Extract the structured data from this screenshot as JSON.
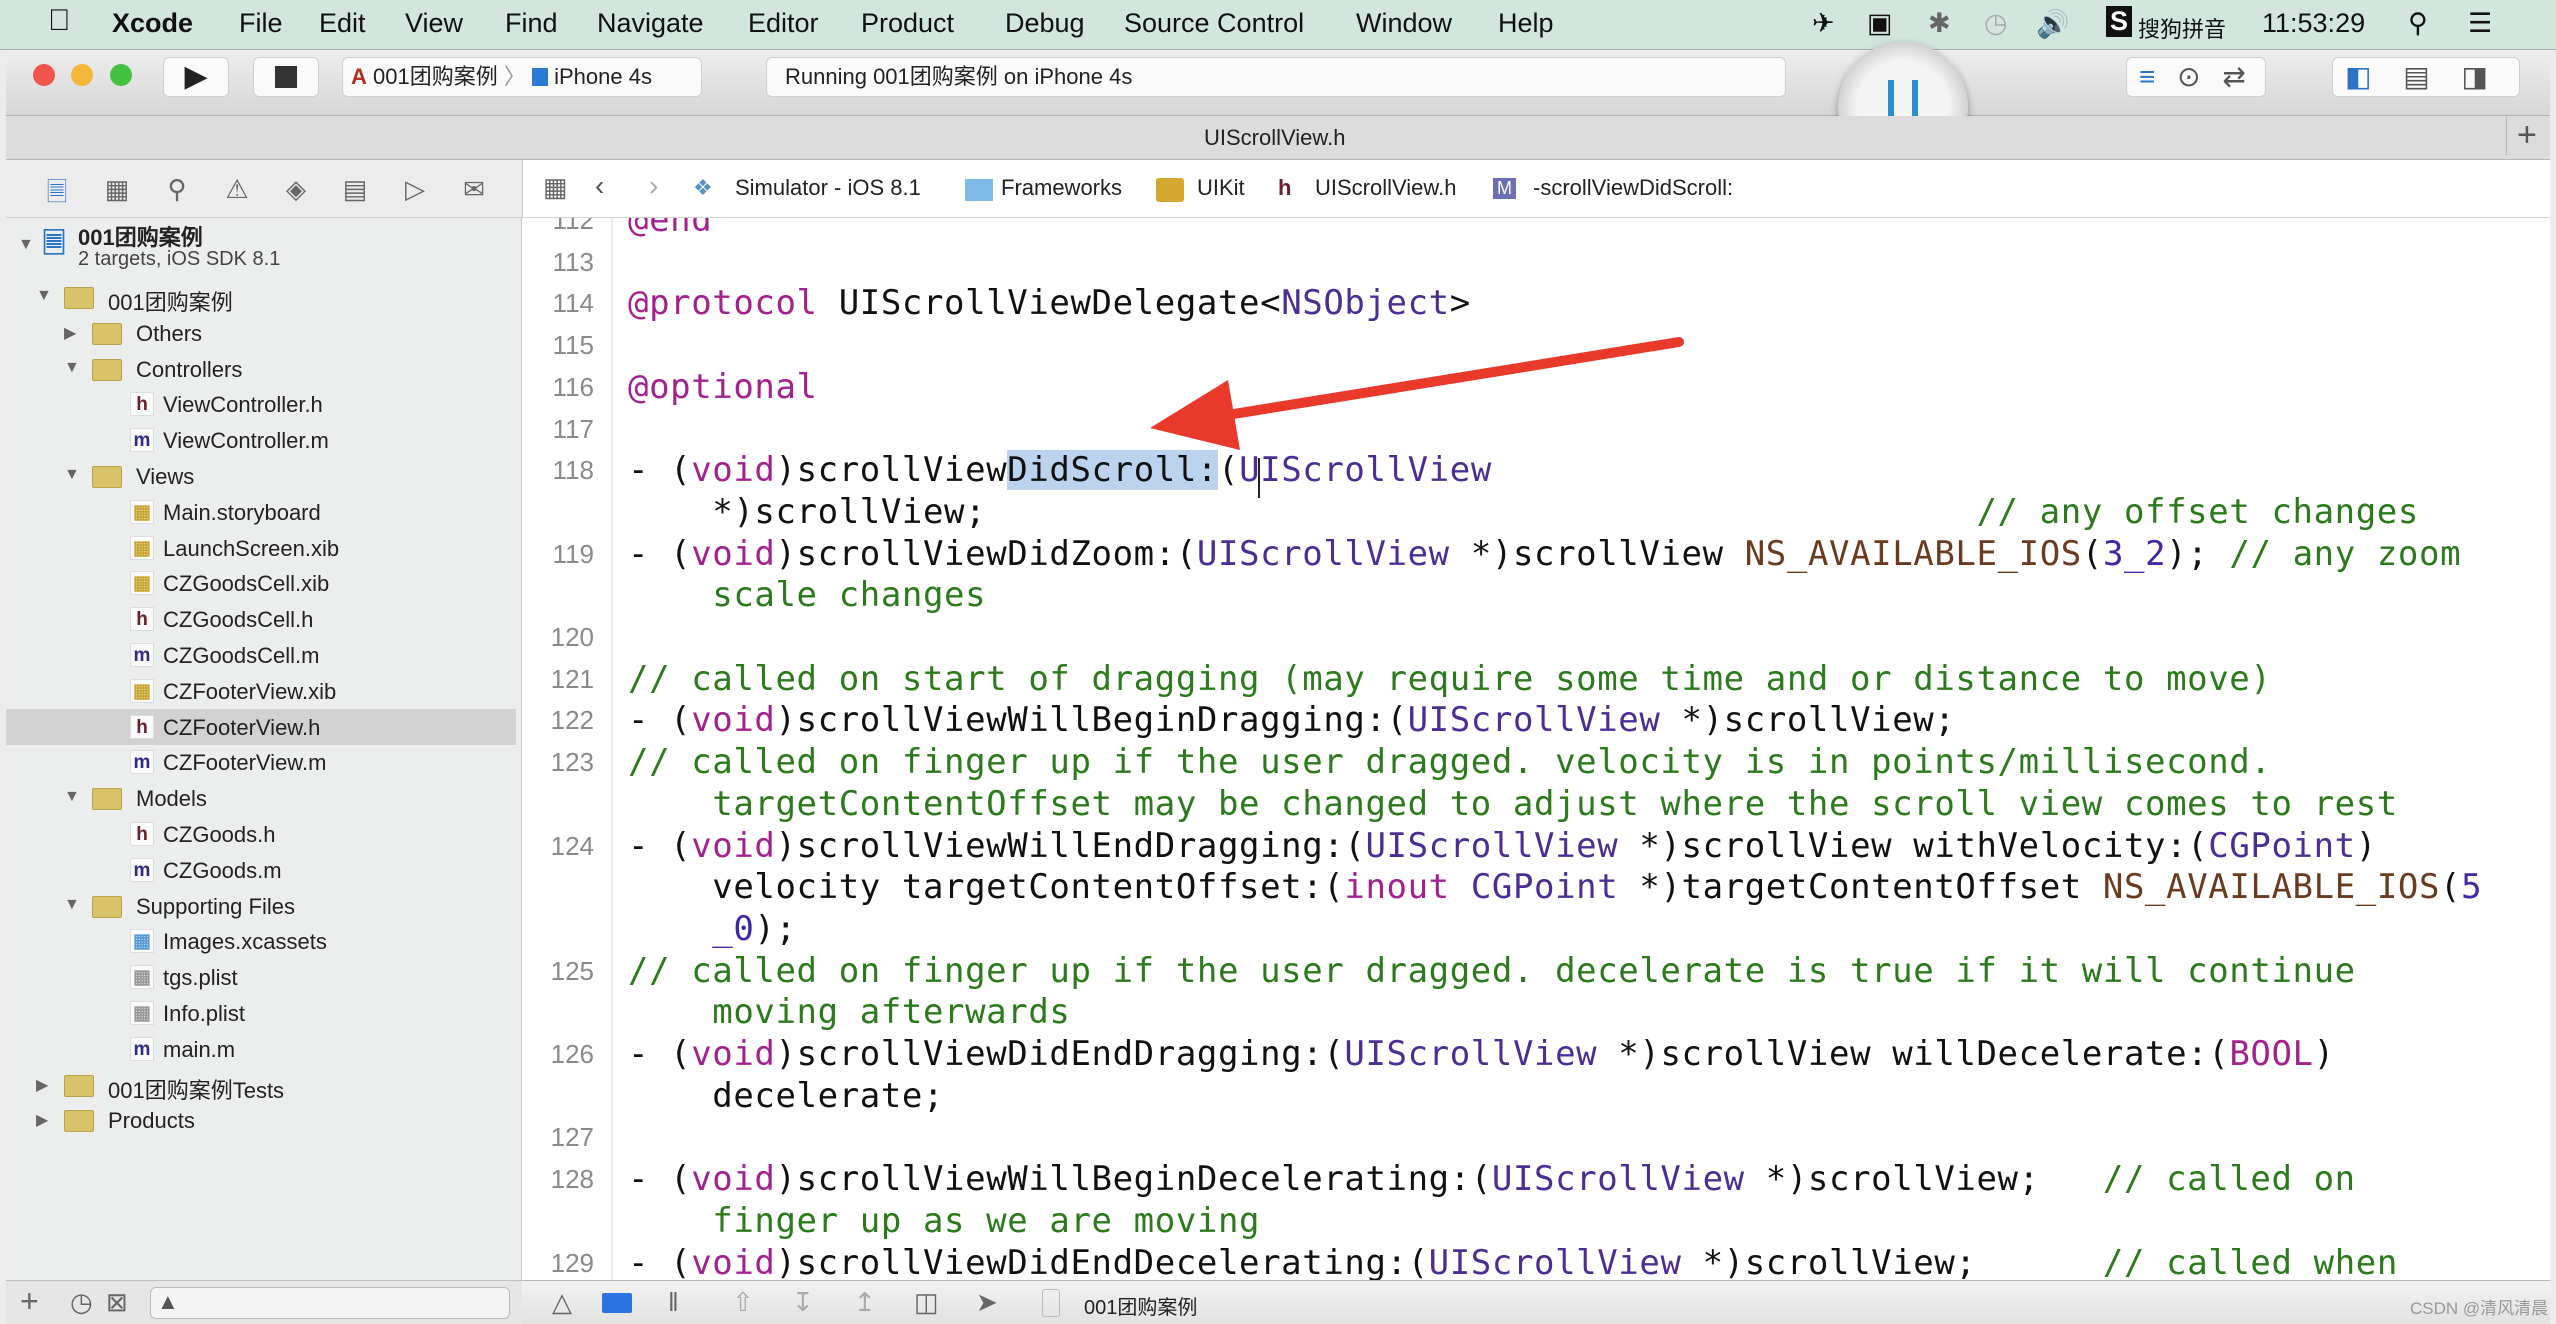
{
  "menubar": {
    "app": "Xcode",
    "items": [
      "File",
      "Edit",
      "View",
      "Find",
      "Navigate",
      "Editor",
      "Product",
      "Debug",
      "Source Control",
      "Window",
      "Help"
    ],
    "input_method": "搜狗拼音",
    "clock": "11:53:29"
  },
  "toolbar": {
    "scheme": "001团购案例",
    "device": "iPhone 4s",
    "status": "Running 001团购案例 on iPhone 4s"
  },
  "tab": {
    "title": "UIScrollView.h",
    "add": "+"
  },
  "jumpbar": {
    "items": [
      "Simulator - iOS 8.1",
      "Frameworks",
      "UIKit",
      "UIScrollView.h",
      "-scrollViewDidScroll:"
    ]
  },
  "navigator": {
    "project": {
      "name": "001团购案例",
      "subtitle": "2 targets, iOS SDK 8.1"
    },
    "items": [
      {
        "label": "001团购案例",
        "kind": "folder",
        "level": 1,
        "open": true
      },
      {
        "label": "Others",
        "kind": "folder",
        "level": 2,
        "open": false
      },
      {
        "label": "Controllers",
        "kind": "folder",
        "level": 2,
        "open": true
      },
      {
        "label": "ViewController.h",
        "kind": "h",
        "level": 3
      },
      {
        "label": "ViewController.m",
        "kind": "m",
        "level": 3
      },
      {
        "label": "Views",
        "kind": "folder",
        "level": 2,
        "open": true
      },
      {
        "label": "Main.storyboard",
        "kind": "ib",
        "level": 3
      },
      {
        "label": "LaunchScreen.xib",
        "kind": "ib",
        "level": 3
      },
      {
        "label": "CZGoodsCell.xib",
        "kind": "ib",
        "level": 3
      },
      {
        "label": "CZGoodsCell.h",
        "kind": "h",
        "level": 3
      },
      {
        "label": "CZGoodsCell.m",
        "kind": "m",
        "level": 3
      },
      {
        "label": "CZFooterView.xib",
        "kind": "ib",
        "level": 3
      },
      {
        "label": "CZFooterView.h",
        "kind": "h",
        "level": 3,
        "selected": true
      },
      {
        "label": "CZFooterView.m",
        "kind": "m",
        "level": 3
      },
      {
        "label": "Models",
        "kind": "folder",
        "level": 2,
        "open": true
      },
      {
        "label": "CZGoods.h",
        "kind": "h",
        "level": 3
      },
      {
        "label": "CZGoods.m",
        "kind": "m",
        "level": 3
      },
      {
        "label": "Supporting Files",
        "kind": "folder",
        "level": 2,
        "open": true
      },
      {
        "label": "Images.xcassets",
        "kind": "assets",
        "level": 3
      },
      {
        "label": "tgs.plist",
        "kind": "plist",
        "level": 3
      },
      {
        "label": "Info.plist",
        "kind": "plist",
        "level": 3
      },
      {
        "label": "main.m",
        "kind": "m",
        "level": 3
      },
      {
        "label": "001团购案例Tests",
        "kind": "folder",
        "level": 1,
        "open": false
      },
      {
        "label": "Products",
        "kind": "folder",
        "level": 1,
        "open": false
      }
    ]
  },
  "code": {
    "rows": [
      {
        "n": "112",
        "s": [
          [
            "@end",
            "k"
          ]
        ]
      },
      {
        "n": "113",
        "s": []
      },
      {
        "n": "114",
        "s": [
          [
            "@protocol",
            "k"
          ],
          [
            " UIScrollViewDelegate<",
            ""
          ],
          [
            "NSObject",
            "t"
          ],
          [
            ">",
            ""
          ]
        ]
      },
      {
        "n": "115",
        "s": []
      },
      {
        "n": "116",
        "s": [
          [
            "@optional",
            "k"
          ]
        ]
      },
      {
        "n": "117",
        "s": []
      },
      {
        "n": "118",
        "s": [
          [
            "- (",
            ""
          ],
          [
            "void",
            "k"
          ],
          [
            ")scrollView",
            ""
          ],
          [
            "DidScroll:",
            "hl"
          ],
          [
            "(",
            ""
          ],
          [
            "UIScrollView",
            "t"
          ]
        ]
      },
      {
        "n": "",
        "s": [
          [
            "    *)scrollView;                                               ",
            ""
          ],
          [
            "// any offset changes",
            "c"
          ]
        ]
      },
      {
        "n": "119",
        "s": [
          [
            "- (",
            ""
          ],
          [
            "void",
            "k"
          ],
          [
            ")scrollViewDidZoom:(",
            ""
          ],
          [
            "UIScrollView",
            "t"
          ],
          [
            " *)scrollView ",
            ""
          ],
          [
            "NS_AVAILABLE_IOS",
            "m"
          ],
          [
            "(",
            ""
          ],
          [
            "3_2",
            "n"
          ],
          [
            "); ",
            ""
          ],
          [
            "// any zoom",
            "c"
          ]
        ]
      },
      {
        "n": "",
        "s": [
          [
            "    scale changes",
            "c"
          ]
        ]
      },
      {
        "n": "120",
        "s": []
      },
      {
        "n": "121",
        "s": [
          [
            "// called on start of dragging (may require some time and or distance to move)",
            "c"
          ]
        ]
      },
      {
        "n": "122",
        "s": [
          [
            "- (",
            ""
          ],
          [
            "void",
            "k"
          ],
          [
            ")scrollViewWillBeginDragging:(",
            ""
          ],
          [
            "UIScrollView",
            "t"
          ],
          [
            " *)scrollView;",
            ""
          ]
        ]
      },
      {
        "n": "123",
        "s": [
          [
            "// called on finger up if the user dragged. velocity is in points/millisecond.",
            "c"
          ]
        ]
      },
      {
        "n": "",
        "s": [
          [
            "    targetContentOffset may be changed to adjust where the scroll view comes to rest",
            "c"
          ]
        ]
      },
      {
        "n": "124",
        "s": [
          [
            "- (",
            ""
          ],
          [
            "void",
            "k"
          ],
          [
            ")scrollViewWillEndDragging:(",
            ""
          ],
          [
            "UIScrollView",
            "t"
          ],
          [
            " *)scrollView withVelocity:(",
            ""
          ],
          [
            "CGPoint",
            "t"
          ],
          [
            ")",
            ""
          ]
        ]
      },
      {
        "n": "",
        "s": [
          [
            "    velocity targetContentOffset:(",
            ""
          ],
          [
            "inout",
            "k"
          ],
          [
            " ",
            ""
          ],
          [
            "CGPoint",
            "t"
          ],
          [
            " *)targetContentOffset ",
            ""
          ],
          [
            "NS_AVAILABLE_IOS",
            "m"
          ],
          [
            "(",
            ""
          ],
          [
            "5",
            "n"
          ]
        ]
      },
      {
        "n": "",
        "s": [
          [
            "    ",
            ""
          ],
          [
            "_0",
            "n"
          ],
          [
            ");",
            ""
          ]
        ]
      },
      {
        "n": "125",
        "s": [
          [
            "// called on finger up if the user dragged. decelerate is true if it will continue",
            "c"
          ]
        ]
      },
      {
        "n": "",
        "s": [
          [
            "    moving afterwards",
            "c"
          ]
        ]
      },
      {
        "n": "126",
        "s": [
          [
            "- (",
            ""
          ],
          [
            "void",
            "k"
          ],
          [
            ")scrollViewDidEndDragging:(",
            ""
          ],
          [
            "UIScrollView",
            "t"
          ],
          [
            " *)scrollView willDecelerate:(",
            ""
          ],
          [
            "BOOL",
            "k"
          ],
          [
            ")",
            ""
          ]
        ]
      },
      {
        "n": "",
        "s": [
          [
            "    decelerate;",
            ""
          ]
        ]
      },
      {
        "n": "127",
        "s": []
      },
      {
        "n": "128",
        "s": [
          [
            "- (",
            ""
          ],
          [
            "void",
            "k"
          ],
          [
            ")scrollViewWillBeginDecelerating:(",
            ""
          ],
          [
            "UIScrollView",
            "t"
          ],
          [
            " *)scrollView;   ",
            ""
          ],
          [
            "// called on",
            "c"
          ]
        ]
      },
      {
        "n": "",
        "s": [
          [
            "    finger up as we are moving",
            "c"
          ]
        ]
      },
      {
        "n": "129",
        "s": [
          [
            "- (",
            ""
          ],
          [
            "void",
            "k"
          ],
          [
            ")scrollViewDidEndDecelerating:(",
            ""
          ],
          [
            "UIScrollView",
            "t"
          ],
          [
            " *)scrollView;      ",
            ""
          ],
          [
            "// called when",
            "c"
          ]
        ]
      }
    ]
  },
  "debugbar": {
    "target": "001团购案例"
  },
  "watermark": "CSDN @清风清晨",
  "colors": {
    "annotation_arrow": "#e8392b",
    "selection": "#bcd3ef",
    "comment": "#2b7a1b",
    "keyword": "#a3218e"
  }
}
